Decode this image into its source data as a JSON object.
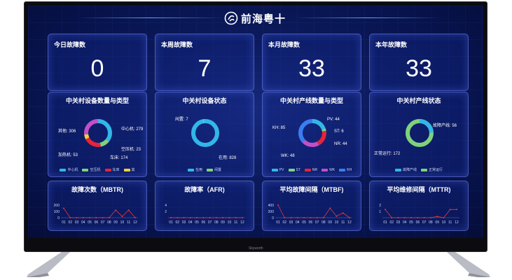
{
  "brand": {
    "name": "前海粤十",
    "tv_label": "Skyworth"
  },
  "kpis": [
    {
      "title": "今日故障数",
      "value": "0"
    },
    {
      "title": "本周故障数",
      "value": "7"
    },
    {
      "title": "本月故障数",
      "value": "33"
    },
    {
      "title": "本年故障数",
      "value": "33"
    }
  ],
  "donuts": [
    {
      "title": "中关村设备数量与类型",
      "labels": [
        "其他: 306",
        "中心机: 279",
        "空压机: 23",
        "车床: 174",
        "加热机: 53"
      ],
      "legend": [
        "中心机",
        "空压机",
        "车床",
        "其"
      ]
    },
    {
      "title": "中关村设备状态",
      "labels": [
        "闲置: 7",
        "在用: 828"
      ],
      "legend": [
        "在用",
        "闲置"
      ]
    },
    {
      "title": "中关村产线数量与类型",
      "labels": [
        "PV: 44",
        "KH: 85",
        "ST: 6",
        "NR: 44",
        "WK: 48"
      ],
      "legend": [
        "PV",
        "ST",
        "NR",
        "WK",
        "KH"
      ]
    },
    {
      "title": "中关村产线状态",
      "labels": [
        "故障产线: 56",
        "正常运行: 172"
      ],
      "legend": [
        "故障产线",
        "正常运行"
      ]
    }
  ],
  "colors": {
    "cyan": "#33b6e8",
    "green": "#7fd27b",
    "red": "#e8233a",
    "yellow": "#f0d03a",
    "purple": "#c24fc8",
    "blue": "#3a7df0",
    "line": "#e33a3a"
  },
  "chart_data": [
    {
      "type": "line",
      "title": "故障次数（MBTR)",
      "x": [
        "01",
        "02",
        "03",
        "04",
        "05",
        "06",
        "07",
        "08",
        "09",
        "10",
        "11",
        "12"
      ],
      "yticks": [
        "200",
        "100",
        "0"
      ],
      "ylim": [
        0,
        200
      ],
      "values": [
        150,
        0,
        0,
        0,
        0,
        0,
        0,
        0,
        120,
        20,
        120,
        0
      ]
    },
    {
      "type": "line",
      "title": "故障率（AFR)",
      "x": [
        "01",
        "02",
        "03",
        "04",
        "05",
        "06",
        "07",
        "08",
        "09",
        "10",
        "11",
        "12"
      ],
      "yticks": [
        "4",
        "2"
      ],
      "ylim": [
        0,
        4
      ],
      "values": [
        0,
        0,
        0,
        0,
        0,
        0,
        0,
        0,
        0,
        0,
        0,
        0
      ]
    },
    {
      "type": "line",
      "title": "平均故障间隔（MTBF)",
      "x": [
        "01",
        "02",
        "03",
        "04",
        "05",
        "06",
        "07",
        "08",
        "09",
        "10",
        "11",
        "12"
      ],
      "yticks": [
        "400",
        "200",
        "0"
      ],
      "ylim": [
        0,
        400
      ],
      "values": [
        400,
        0,
        0,
        0,
        0,
        0,
        0,
        0,
        300,
        50,
        150,
        0
      ]
    },
    {
      "type": "line",
      "title": "平均维修间隔（MTTR)",
      "x": [
        "01",
        "02",
        "03",
        "04",
        "05",
        "06",
        "07",
        "08",
        "09",
        "10",
        "11",
        "12"
      ],
      "yticks": [
        "2",
        "1"
      ],
      "ylim": [
        0,
        2
      ],
      "values": [
        1.3,
        0,
        0,
        0,
        0,
        0,
        0,
        0,
        0.2,
        0,
        1.3,
        1.3
      ]
    }
  ]
}
